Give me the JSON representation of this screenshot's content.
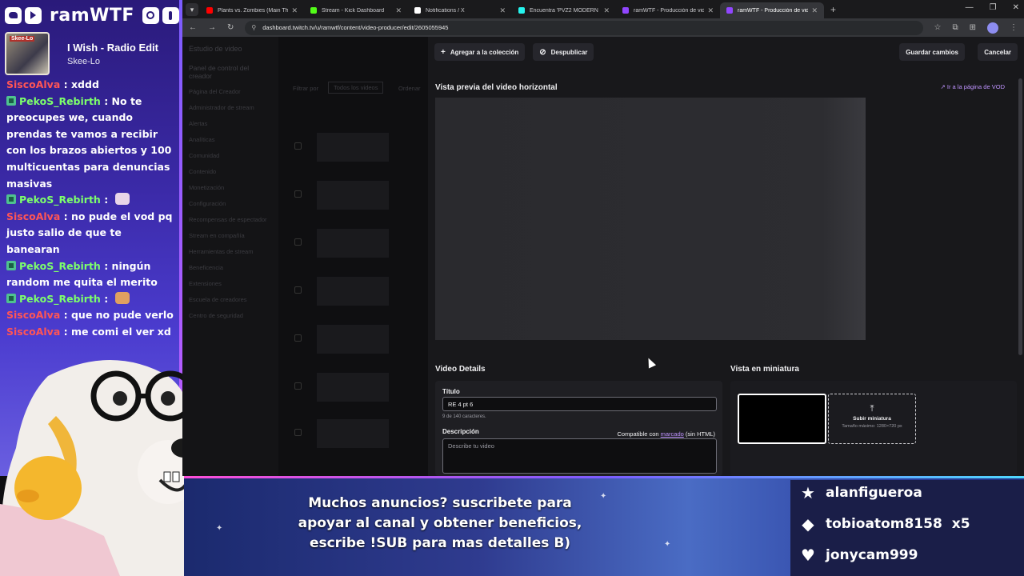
{
  "overlay": {
    "channel_name": "ramWTF",
    "social_icons": [
      "twitter-icon",
      "youtube-icon",
      "instagram-icon",
      "tiktok-icon"
    ],
    "now_playing": {
      "title": "I Wish - Radio Edit",
      "artist": "Skee-Lo",
      "art_label": "Skee-Lo"
    },
    "chat": [
      {
        "user": "SiscoAlva",
        "color": "#ff5555",
        "badge": false,
        "text": " : xddd"
      },
      {
        "user": "PekoS_Rebirth",
        "color": "#7dff6b",
        "badge": true,
        "text": " : No te preocupes we, cuando prendas te vamos a recibir con los brazos abiertos y 100 multicuentas para denuncias masivas"
      },
      {
        "user": "PekoS_Rebirth",
        "color": "#7dff6b",
        "badge": true,
        "text": " : ",
        "emote": "#e8d6e8"
      },
      {
        "user": "SiscoAlva",
        "color": "#ff5555",
        "badge": false,
        "text": " : no pude el vod pq justo salio de que te banearan"
      },
      {
        "user": "PekoS_Rebirth",
        "color": "#7dff6b",
        "badge": true,
        "text": " : ningún random me quita el merito"
      },
      {
        "user": "PekoS_Rebirth",
        "color": "#7dff6b",
        "badge": true,
        "text": " : ",
        "emote": "#e0a060"
      },
      {
        "user": "SiscoAlva",
        "color": "#ff5555",
        "badge": false,
        "text": " : que no pude verlo"
      },
      {
        "user": "SiscoAlva",
        "color": "#ff5555",
        "badge": false,
        "text": " : me comi el ver xd"
      }
    ]
  },
  "browser": {
    "tabs": [
      {
        "label": "Plants vs. Zombies (Main Theme)",
        "favicon": "#ff0000",
        "active": false
      },
      {
        "label": "Stream - Kick Dashboard",
        "favicon": "#53fc18",
        "active": false
      },
      {
        "label": "Notifications / X",
        "favicon": "#ffffff",
        "active": false
      },
      {
        "label": "Encuentra 'PVZ2 MODERN DAY'",
        "favicon": "#25f4ee",
        "active": false
      },
      {
        "label": "ramWTF - Producción de video",
        "favicon": "#9146ff",
        "active": false
      },
      {
        "label": "ramWTF - Producción de video",
        "favicon": "#9146ff",
        "active": true
      }
    ],
    "url": "dashboard.twitch.tv/u/ramwtf/content/video-producer/edit/2605055945"
  },
  "backdrop": {
    "header": "Estudio de video",
    "section": "Panel de control del creador",
    "filter_label": "Filtrar por",
    "filter_value": "Todos los videos",
    "sort_label": "Ordenar",
    "menu": [
      "Página del Creador",
      "Administrador de stream",
      "Alertas",
      "Analíticas",
      "Comunidad",
      "Contenido",
      "Monetización",
      "Configuración",
      "Recompensas de espectador",
      "Stream en compañía",
      "Herramientas de stream",
      "Beneficencia",
      "Extensiones",
      "Escuela de creadores",
      "Centro de seguridad"
    ]
  },
  "modal": {
    "add_collection": "Agregar a la colección",
    "unpublish": "Despublicar",
    "save": "Guardar cambios",
    "cancel": "Cancelar",
    "preview_title": "Vista previa del video horizontal",
    "vod_link": "Ir a la página de VOD",
    "details_title": "Video Details",
    "thumb_title": "Vista en miniatura",
    "title_label": "Título",
    "title_value": "RE 4 pt 6",
    "char_count": "9 de 140 caracteres.",
    "desc_label": "Descripción",
    "compat_prefix": "Compatible con ",
    "compat_link": "marcado",
    "compat_suffix": " (sin HTML)",
    "desc_placeholder": "Describe tu video",
    "upload_label": "Subir miniatura",
    "upload_hint": "Tamaño máximo: 1280×720 px"
  },
  "banner": {
    "text": "Muchos anuncios? suscribete para apoyar al canal y obtener beneficios, escribe !SUB para mas detalles B)"
  },
  "events": [
    {
      "icon": "star-icon",
      "user": "alanfigueroa",
      "extra": ""
    },
    {
      "icon": "diamond-icon",
      "user": "tobioatom8158",
      "extra": "x5"
    },
    {
      "icon": "heart-icon",
      "user": "jonycam999",
      "extra": ""
    }
  ]
}
